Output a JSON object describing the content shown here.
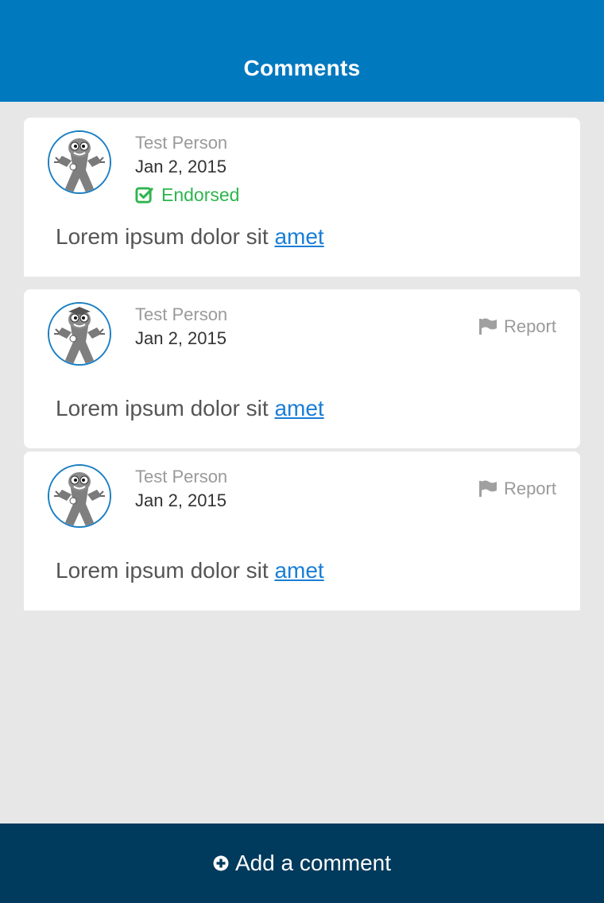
{
  "header": {
    "title": "Comments"
  },
  "comments": [
    {
      "author": "Test Person",
      "date": "Jan 2, 2015",
      "endorsed_label": "Endorsed",
      "text": "Lorem ipsum dolor sit ",
      "link": "amet"
    },
    {
      "author": "Test Person",
      "date": "Jan 2, 2015",
      "report_label": "Report",
      "text": "Lorem ipsum dolor sit ",
      "link": "amet"
    },
    {
      "author": "Test Person",
      "date": "Jan 2, 2015",
      "report_label": "Report",
      "text": "Lorem ipsum dolor sit ",
      "link": "amet"
    }
  ],
  "footer": {
    "add_label": "Add a comment",
    "icon": "plus-circle-icon"
  },
  "colors": {
    "header": "#0079bf",
    "footer": "#003a5c",
    "endorsed": "#2fb44e",
    "link": "#1a7ed6",
    "background": "#e7e7e7"
  },
  "icons": {
    "avatar": "avatar-icon",
    "endorsed": "check-square-icon",
    "report": "flag-icon"
  }
}
